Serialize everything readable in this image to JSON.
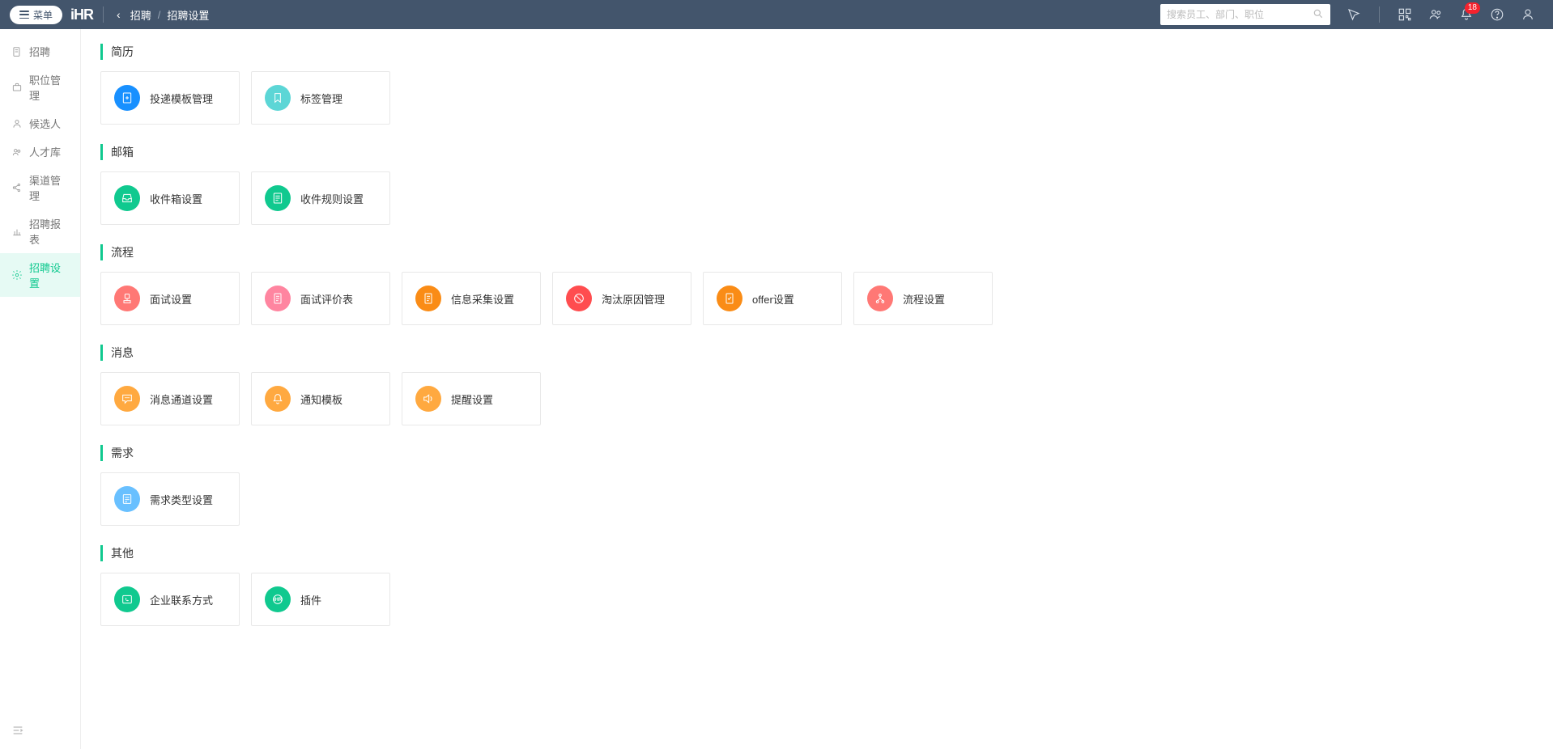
{
  "header": {
    "menu_label": "菜单",
    "logo_text": "iHR",
    "breadcrumb": {
      "parent": "招聘",
      "current": "招聘设置"
    },
    "search_placeholder": "搜索员工、部门、职位",
    "notification_count": "18"
  },
  "sidebar": {
    "items": [
      {
        "label": "招聘",
        "icon": "file"
      },
      {
        "label": "职位管理",
        "icon": "briefcase"
      },
      {
        "label": "候选人",
        "icon": "user"
      },
      {
        "label": "人才库",
        "icon": "users"
      },
      {
        "label": "渠道管理",
        "icon": "share"
      },
      {
        "label": "招聘报表",
        "icon": "chart"
      },
      {
        "label": "招聘设置",
        "icon": "gear",
        "active": true
      }
    ]
  },
  "sections": [
    {
      "title": "简历",
      "cards": [
        {
          "label": "投递模板管理",
          "color": "ic-blue",
          "icon": "doc-plus",
          "name": "card-submit-template"
        },
        {
          "label": "标签管理",
          "color": "ic-cyan",
          "icon": "bookmark",
          "name": "card-tag-manage"
        }
      ]
    },
    {
      "title": "邮箱",
      "cards": [
        {
          "label": "收件箱设置",
          "color": "ic-green",
          "icon": "inbox",
          "name": "card-inbox-settings"
        },
        {
          "label": "收件规则设置",
          "color": "ic-green",
          "icon": "list-doc",
          "name": "card-inbox-rules"
        }
      ]
    },
    {
      "title": "流程",
      "cards": [
        {
          "label": "面试设置",
          "color": "ic-coral",
          "icon": "stamp",
          "name": "card-interview-settings"
        },
        {
          "label": "面试评价表",
          "color": "ic-pink",
          "icon": "doc",
          "name": "card-interview-eval"
        },
        {
          "label": "信息采集设置",
          "color": "ic-orange2",
          "icon": "doc",
          "name": "card-info-collect"
        },
        {
          "label": "淘汰原因管理",
          "color": "ic-red",
          "icon": "forbid",
          "name": "card-reject-reason"
        },
        {
          "label": "offer设置",
          "color": "ic-orange2",
          "icon": "doc-check",
          "name": "card-offer-settings"
        },
        {
          "label": "流程设置",
          "color": "ic-coral",
          "icon": "flow",
          "name": "card-flow-settings"
        }
      ]
    },
    {
      "title": "消息",
      "cards": [
        {
          "label": "消息通道设置",
          "color": "ic-orange",
          "icon": "chat",
          "name": "card-msg-channel"
        },
        {
          "label": "通知模板",
          "color": "ic-orange",
          "icon": "bell",
          "name": "card-notify-template"
        },
        {
          "label": "提醒设置",
          "color": "ic-orange",
          "icon": "speaker",
          "name": "card-reminder"
        }
      ]
    },
    {
      "title": "需求",
      "cards": [
        {
          "label": "需求类型设置",
          "color": "ic-lightblue",
          "icon": "list",
          "name": "card-demand-type"
        }
      ]
    },
    {
      "title": "其他",
      "cards": [
        {
          "label": "企业联系方式",
          "color": "ic-green",
          "icon": "phone-card",
          "name": "card-contact"
        },
        {
          "label": "插件",
          "color": "ic-green",
          "icon": "plugin",
          "name": "card-plugin"
        }
      ]
    }
  ]
}
